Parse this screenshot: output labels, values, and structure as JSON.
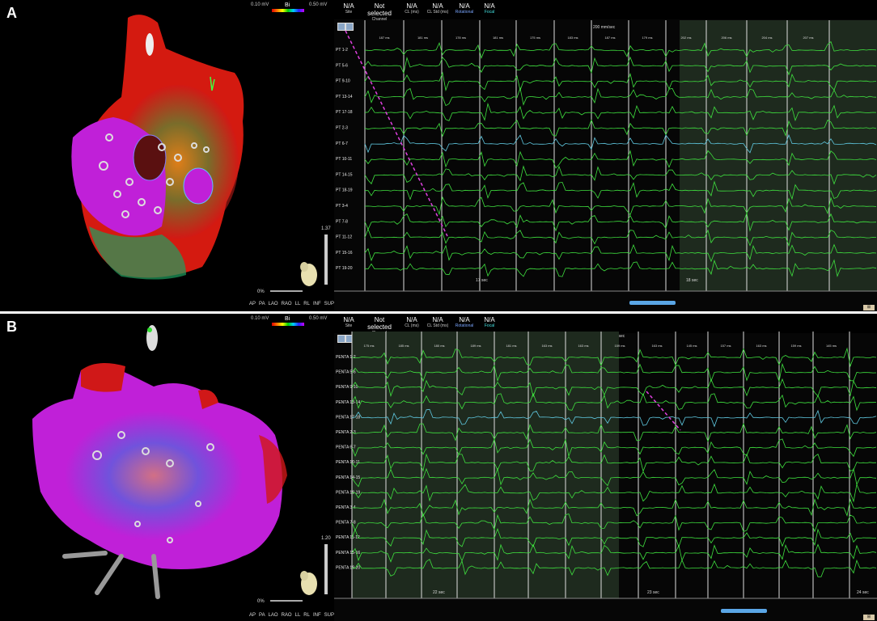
{
  "panel_a": {
    "letter": "A",
    "scale": {
      "min": "0.10 mV",
      "type": "Bi",
      "max": "0.50 mV"
    },
    "zoom_ratio": "1.37",
    "zoom_pct": "0%",
    "views": [
      "AP",
      "PA",
      "LAO",
      "RAO",
      "LL",
      "RL",
      "INF",
      "SUP"
    ],
    "header": [
      {
        "value": "N/A",
        "label": "Site"
      },
      {
        "value": "Not selected",
        "label": "Channel"
      },
      {
        "value": "N/A",
        "label": "CL (ms)"
      },
      {
        "value": "N/A",
        "label": "CL Std (ms)"
      },
      {
        "value": "N/A",
        "label": "Rotational"
      },
      {
        "value": "N/A",
        "label": "Focal"
      }
    ],
    "speed": "200 mm/sec",
    "cycle_lengths": [
      "187 ms",
      "181 ms",
      "178 ms",
      "181 ms",
      "175 ms",
      "183 ms",
      "187 ms",
      "179 ms",
      "202 ms",
      "206 ms",
      "204 ms",
      "207 ms"
    ],
    "channels": [
      "PT 1-2",
      "PT 5-6",
      "PT 9-10",
      "PT 13-14",
      "PT 17-18",
      "PT 2-3",
      "PT 6-7",
      "PT 10-11",
      "PT 14-15",
      "PT 18-19",
      "PT 3-4",
      "PT 7-8",
      "PT 11-12",
      "PT 15-16",
      "PT 19-20"
    ],
    "time_labels": [
      "17 sec",
      "18 sec"
    ]
  },
  "panel_b": {
    "letter": "B",
    "scale": {
      "min": "0.10 mV",
      "type": "Bi",
      "max": "0.50 mV"
    },
    "zoom_ratio": "1.20",
    "zoom_pct": "0%",
    "views": [
      "AP",
      "PA",
      "LAO",
      "RAO",
      "LL",
      "RL",
      "INF",
      "SUP"
    ],
    "header": [
      {
        "value": "N/A",
        "label": "Site"
      },
      {
        "value": "Not selected",
        "label": "Channel"
      },
      {
        "value": "N/A",
        "label": "CL (ms)"
      },
      {
        "value": "N/A",
        "label": "CL Std (ms)"
      },
      {
        "value": "N/A",
        "label": "Rotational"
      },
      {
        "value": "N/A",
        "label": "Focal"
      }
    ],
    "speed": "200 mm/sec",
    "cycle_lengths": [
      "175 ms",
      "185 ms",
      "180 ms",
      "189 ms",
      "181 ms",
      "163 ms",
      "163 ms",
      "159 ms",
      "163 ms",
      "145 ms",
      "157 ms",
      "163 ms",
      "159 ms",
      "145 ms",
      "165 ms"
    ],
    "channels": [
      "PENTA 1-2",
      "PENTA 5-6",
      "PENTA 9-10",
      "PENTA 13-14",
      "PENTA 17-18",
      "PENTA 2-3",
      "PENTA 6-7",
      "PENTA 10-11",
      "PENTA 14-15",
      "PENTA 18-19",
      "PENTA 3-4",
      "PENTA 7-8",
      "PENTA 11-12",
      "PENTA 15-16",
      "PENTA 19-20"
    ],
    "time_labels": [
      "22 sec",
      "23 sec",
      "24 sec"
    ]
  },
  "colors": {
    "trace": "#3fe03f",
    "highlight_trace": "#5fc8e0",
    "annotation": "#e040e0",
    "shade": "#1e2a1e"
  }
}
